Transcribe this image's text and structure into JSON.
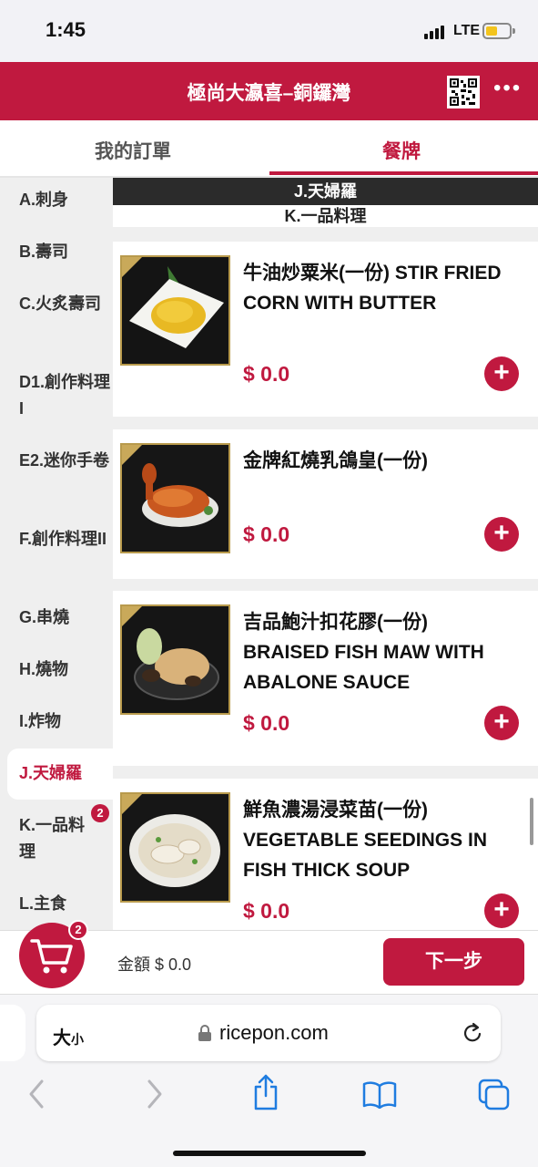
{
  "status_bar": {
    "time": "1:45",
    "network": "LTE"
  },
  "header": {
    "title": "極尚大瀛喜–銅鑼灣"
  },
  "tabs": {
    "orders": "我的訂單",
    "menu": "餐牌"
  },
  "sidebar": {
    "categories": [
      {
        "label": "A.刺身"
      },
      {
        "label": "B.壽司"
      },
      {
        "label": "C.火炙壽司"
      },
      {
        "label": "D1.創作料理I"
      },
      {
        "label": "E2.迷你手卷"
      },
      {
        "label": "F.創作料理II"
      },
      {
        "label": "G.串燒"
      },
      {
        "label": "H.燒物"
      },
      {
        "label": "I.炸物"
      },
      {
        "label": "J.天婦羅"
      },
      {
        "label": "K.一品料理",
        "badge": "2"
      },
      {
        "label": "L.主食"
      }
    ]
  },
  "content": {
    "sticky_section": "J.天婦羅",
    "current_section": "K.一品料理",
    "items": [
      {
        "name": "牛油炒粟米(一份) STIR FRIED CORN WITH BUTTER",
        "price": "$ 0.0"
      },
      {
        "name": "金牌紅燒乳鴿皇(一份)",
        "price": "$ 0.0"
      },
      {
        "name": "吉品鮑汁扣花膠(一份) BRAISED FISH MAW WITH ABALONE SAUCE",
        "price": "$ 0.0"
      },
      {
        "name": "鮮魚濃湯浸菜苗(一份) VEGETABLE SEEDINGS IN FISH THICK SOUP",
        "price": "$ 0.0"
      }
    ],
    "add_symbol": "+"
  },
  "cart": {
    "count": "2",
    "total_label": "金額 $ 0.0",
    "next_label": "下一步"
  },
  "browser": {
    "text_size_big": "大",
    "text_size_small": "小",
    "url": "ricepon.com"
  },
  "colors": {
    "brand": "#c0193f"
  }
}
